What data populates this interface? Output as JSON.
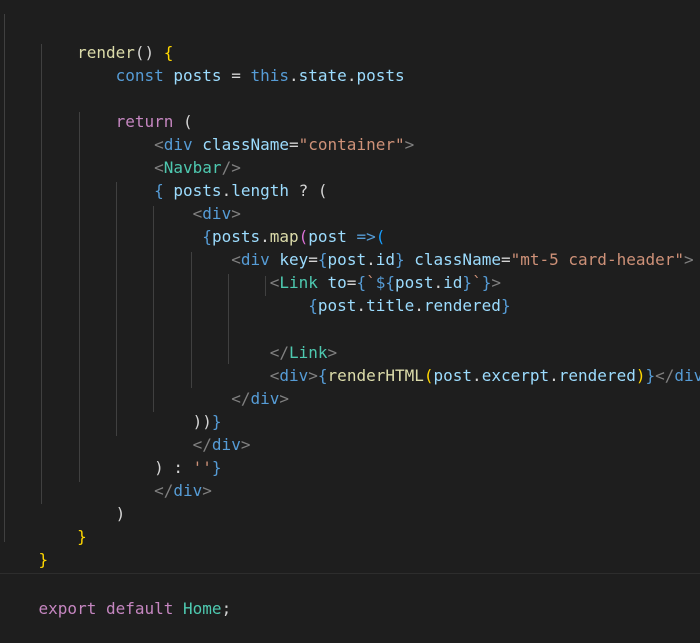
{
  "editor": {
    "lines": [
      [
        "    ",
        "render",
        "() ",
        "{"
      ],
      [
        "        ",
        "const ",
        "posts",
        " = ",
        "this",
        ".",
        "state",
        ".",
        "posts"
      ],
      [
        ""
      ],
      [
        "        ",
        "return",
        " ("
      ],
      [
        "            ",
        "<",
        "div ",
        "className",
        "=",
        "\"container\"",
        ">"
      ],
      [
        "            ",
        "<",
        "Navbar",
        "/>"
      ],
      [
        "            ",
        "{",
        " posts",
        ".",
        "length",
        " ? ("
      ],
      [
        "                ",
        "<",
        "div",
        ">"
      ],
      [
        "                 ",
        "{",
        "posts",
        ".",
        "map",
        "(",
        "post ",
        "=>",
        "("
      ],
      [
        "                    ",
        "<",
        "div ",
        "key",
        "=",
        "{",
        "post",
        ".",
        "id",
        "}",
        " ",
        "className",
        "=",
        "\"mt-5 card-header\"",
        ">"
      ],
      [
        "                        ",
        "<",
        "Link ",
        "to",
        "=",
        "{",
        "`",
        "${",
        "post",
        ".",
        "id",
        "}",
        "`",
        "}",
        ">"
      ],
      [
        "                            ",
        "{",
        "post",
        ".",
        "title",
        ".",
        "rendered",
        "}"
      ],
      [
        ""
      ],
      [
        "                        ",
        "</",
        "Link",
        ">"
      ],
      [
        "                        ",
        "<",
        "div",
        ">",
        "{",
        "renderHTML",
        "(",
        "post",
        ".",
        "excerpt",
        ".",
        "rendered",
        ")",
        "}",
        "</",
        "div",
        ">"
      ],
      [
        "                    ",
        "</",
        "div",
        ">"
      ],
      [
        "                ",
        "))",
        "}"
      ],
      [
        "                ",
        "</",
        "div",
        ">"
      ],
      [
        "            ",
        ") : ",
        "''",
        "}"
      ],
      [
        "            ",
        "</",
        "div",
        ">"
      ],
      [
        "        ",
        ")"
      ],
      [
        "    ",
        "}"
      ],
      [
        "}"
      ],
      [
        ""
      ],
      [
        "export ",
        "default ",
        "Home",
        ";"
      ]
    ]
  },
  "colors": {
    "background": "#1e1e1e",
    "function": "#dcdcaa",
    "keyword": "#569cd6",
    "variable": "#9cdcfe",
    "component": "#4ec9b0",
    "string": "#ce9178",
    "control": "#c586c0",
    "bracket_pink": "#da70d6",
    "bracket_yellow": "#ffd700",
    "bracket_blue": "#179fff",
    "tag_punct": "#808080"
  }
}
